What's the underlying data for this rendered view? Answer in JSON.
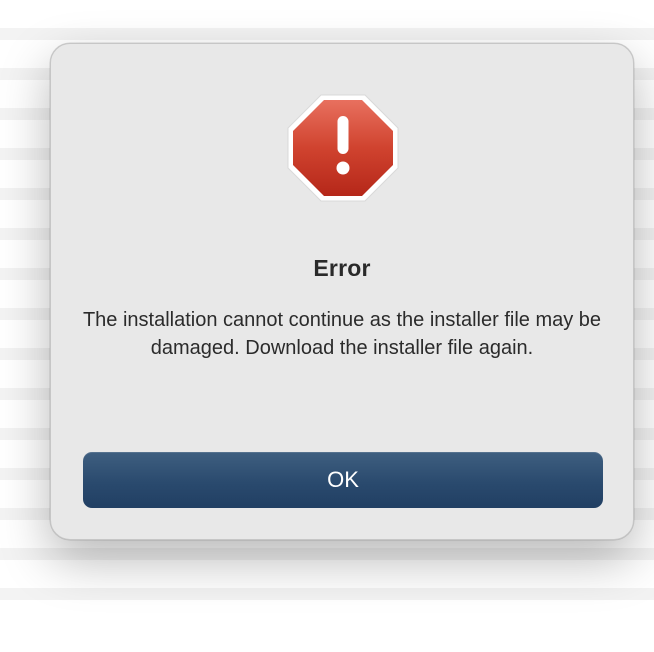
{
  "dialog": {
    "icon": "stop-sign-exclamation-icon",
    "title": "Error",
    "message": "The installation cannot continue as the installer file may be damaged. Download the installer file again.",
    "ok_label": "OK"
  },
  "colors": {
    "button": "#2a4a6e",
    "icon_red": "#c8352b",
    "dialog_bg": "#e8e8e8"
  }
}
